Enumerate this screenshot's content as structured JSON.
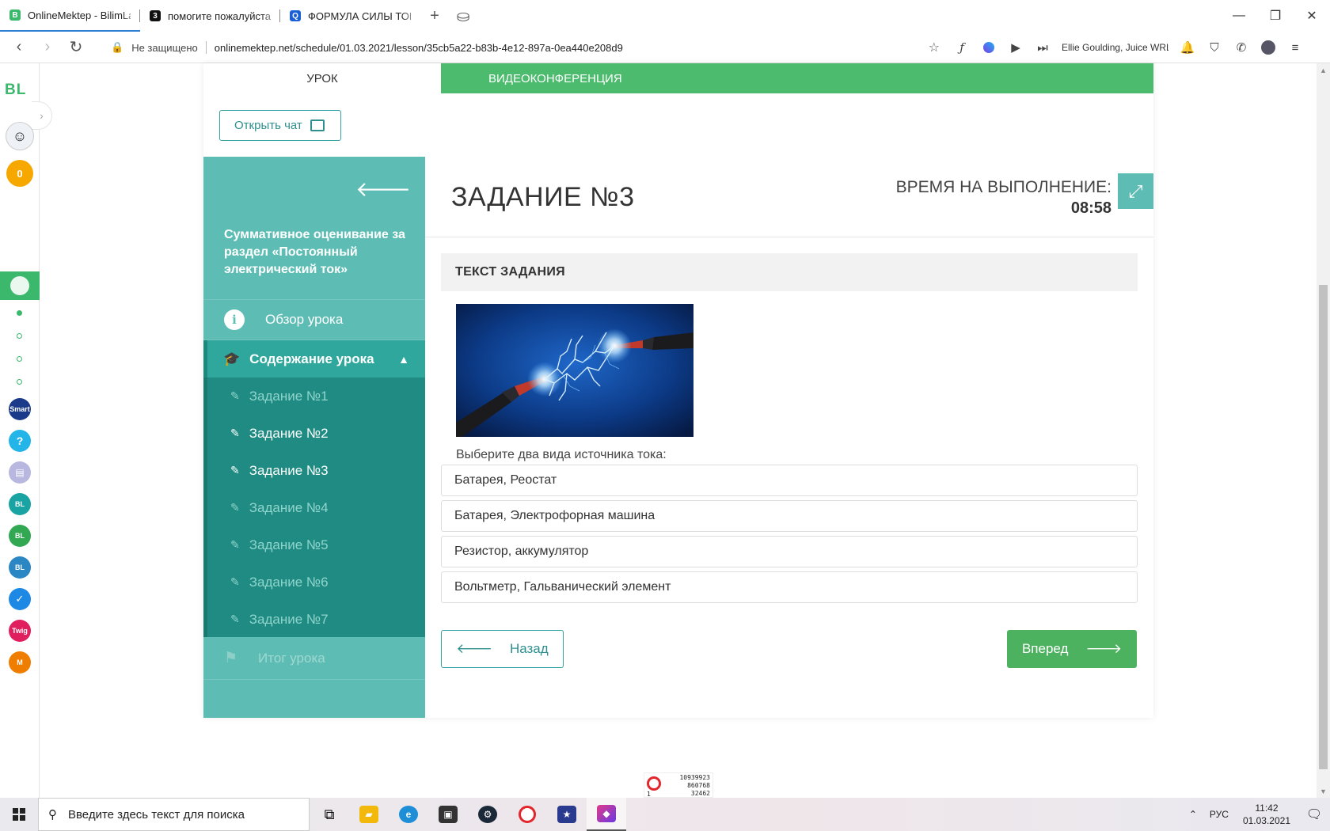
{
  "browser": {
    "tabs": [
      {
        "label": "OnlineMektep - BilimLand",
        "favicon_color": "#3bb86b",
        "favicon_glyph": "B",
        "active": true
      },
      {
        "label": "помогите пожалуйста",
        "favicon_color": "#111111",
        "favicon_glyph": "3",
        "active": false
      },
      {
        "label": "ФОРМУЛА СИЛЫ ТОКА",
        "favicon_color": "#1a5fd6",
        "favicon_glyph": "Q",
        "active": false
      }
    ],
    "insecure_label": "Не защищено",
    "url": "onlinemektep.net/schedule/01.03.2021/lesson/35cb5a22-b83b-4e12-897a-0ea440e208d9",
    "media_track": "Ellie Goulding, Juice WRLD"
  },
  "rail": {
    "logo": "BL",
    "coins": "0",
    "apps": [
      {
        "name": "smart-school",
        "color": "#1b3b8a",
        "label": "Smart"
      },
      {
        "name": "help",
        "color": "#23b5e8",
        "label": "?"
      },
      {
        "name": "keyboard",
        "color": "#b7b7e0",
        "label": "▤"
      },
      {
        "name": "bilim-online",
        "color": "#1aa3a3",
        "label": "BL"
      },
      {
        "name": "bilim-land",
        "color": "#32a852",
        "label": "BL"
      },
      {
        "name": "bilim-book",
        "color": "#2b86c4",
        "label": "BL"
      },
      {
        "name": "task-app",
        "color": "#1e88e5",
        "label": "✓"
      },
      {
        "name": "twig",
        "color": "#e01f5e",
        "label": "Twig"
      },
      {
        "name": "mektep",
        "color": "#ef7d00",
        "label": "M"
      }
    ]
  },
  "lesson": {
    "tab_lesson": "УРОК",
    "tab_video": "ВИДЕОКОНФЕРЕНЦИЯ",
    "chat_button": "Открыть чат",
    "section_title": "Суммативное оценивание за раздел «Постоянный электрический ток»",
    "overview": "Обзор урока",
    "content": "Содержание урока",
    "tasks": [
      {
        "label": "Задание №1",
        "done": false
      },
      {
        "label": "Задание №2",
        "done": true
      },
      {
        "label": "Задание №3",
        "done": true
      },
      {
        "label": "Задание №4",
        "done": false
      },
      {
        "label": "Задание №5",
        "done": false
      },
      {
        "label": "Задание №6",
        "done": false
      },
      {
        "label": "Задание №7",
        "done": false
      }
    ],
    "summary": "Итог урока",
    "task_title": "ЗАДАНИЕ №3",
    "timer_label": "ВРЕМЯ НА ВЫПОЛНЕНИЕ:",
    "timer_value": "08:58",
    "text_header": "ТЕКСТ ЗАДАНИЯ",
    "question": "Выберите два вида источника тока:",
    "options": [
      "Батарея, Реостат",
      "Батарея, Электрофорная машина",
      "Резистор, аккумулятор",
      "Вольтметр, Гальванический элемент"
    ],
    "back_button": "Назад",
    "next_button": "Вперед"
  },
  "widget": {
    "line1": "10939923",
    "line2": "860768",
    "line3": "32462",
    "line4": "1"
  },
  "taskbar": {
    "search_placeholder": "Введите здесь текст для поиска",
    "language": "РУС",
    "time": "11:42",
    "date": "01.03.2021"
  }
}
